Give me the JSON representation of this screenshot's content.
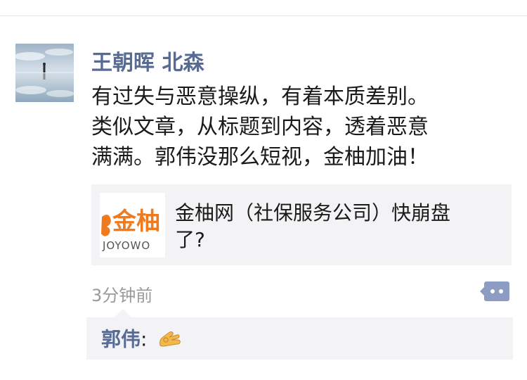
{
  "post": {
    "author": "王朝晖 北森",
    "text_lines": [
      "有过失与恶意操纵，有着本质差别。",
      "类似文章，从标题到内容，透着恶意",
      "满满。郭伟没那么短视，金柚加油！"
    ],
    "link": {
      "title_lines": [
        "金柚网（社保服务公司）快崩盘",
        "了?"
      ],
      "thumbnail_text": "金柚",
      "thumbnail_subtext": "JOYOWO"
    },
    "time": "3分钟前"
  },
  "comment": {
    "commenter": "郭伟",
    "separator": ":",
    "emoji": "ok-hand-emoji"
  },
  "colors": {
    "name_link": "#576b95",
    "body_text": "#1a1a1a",
    "meta_text": "#9a9a9a",
    "card_bg": "#f3f3f5",
    "thumb_orange": "#f07b1f"
  },
  "icons": {
    "comment_button": "comment-bubble-icon"
  }
}
